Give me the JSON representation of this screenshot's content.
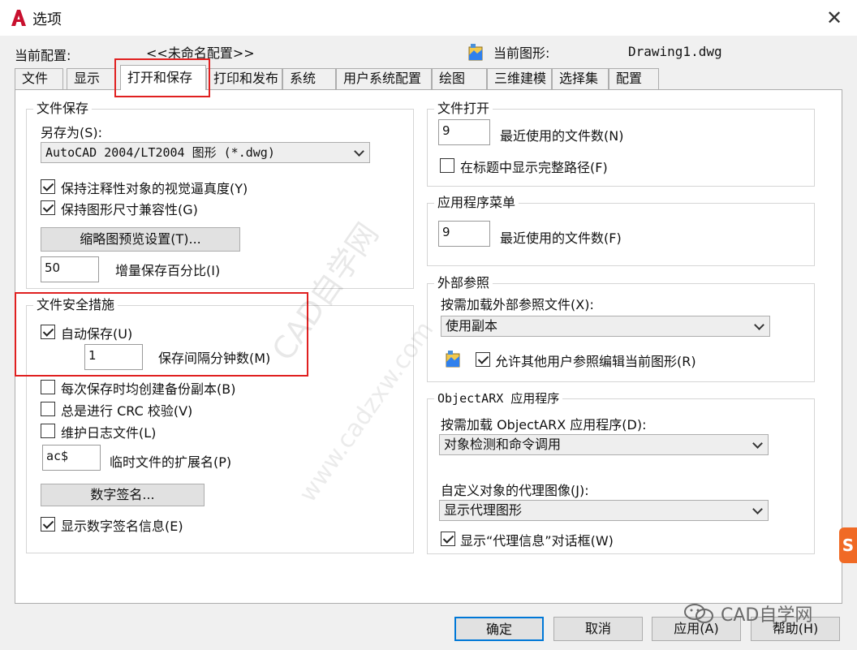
{
  "window": {
    "title": "选项",
    "close_glyph": "✕"
  },
  "profile": {
    "current_profile_label": "当前配置:",
    "current_profile_value": "<<未命名配置>>",
    "current_drawing_label": "当前图形:",
    "current_drawing_value": "Drawing1.dwg"
  },
  "tabs": [
    {
      "label": "文件"
    },
    {
      "label": "显示"
    },
    {
      "label": "打开和保存",
      "active": true
    },
    {
      "label": "打印和发布"
    },
    {
      "label": "系统"
    },
    {
      "label": "用户系统配置"
    },
    {
      "label": "绘图"
    },
    {
      "label": "三维建模"
    },
    {
      "label": "选择集"
    },
    {
      "label": "配置"
    }
  ],
  "file_save": {
    "title": "文件保存",
    "save_as_label": "另存为(S):",
    "save_as_value": "AutoCAD 2004/LT2004 图形 (*.dwg)",
    "keep_annotative_label": "保持注释性对象的视觉逼真度(Y)",
    "keep_annotative_checked": true,
    "keep_drawing_size_label": "保持图形尺寸兼容性(G)",
    "keep_drawing_size_checked": true,
    "thumbnail_button": "缩略图预览设置(T)...",
    "incremental_value": "50",
    "incremental_label": "增量保存百分比(I)"
  },
  "file_safety": {
    "title": "文件安全措施",
    "autosave_label": "自动保存(U)",
    "autosave_checked": true,
    "minutes_value": "1",
    "minutes_label": "保存间隔分钟数(M)",
    "backup_label": "每次保存时均创建备份副本(B)",
    "backup_checked": false,
    "crc_label": "总是进行 CRC 校验(V)",
    "crc_checked": false,
    "log_label": "维护日志文件(L)",
    "log_checked": false,
    "temp_ext_value": "ac$",
    "temp_ext_label": "临时文件的扩展名(P)",
    "digital_sig_button": "数字签名...",
    "show_sig_label": "显示数字签名信息(E)",
    "show_sig_checked": true
  },
  "file_open": {
    "title": "文件打开",
    "recent_value": "9",
    "recent_label": "最近使用的文件数(N)",
    "full_path_label": "在标题中显示完整路径(F)",
    "full_path_checked": false
  },
  "app_menu": {
    "title": "应用程序菜单",
    "recent_value": "9",
    "recent_label": "最近使用的文件数(F)"
  },
  "xref": {
    "title": "外部参照",
    "demand_load_label": "按需加载外部参照文件(X):",
    "demand_load_value": "使用副本",
    "allow_edit_label": "允许其他用户参照编辑当前图形(R)",
    "allow_edit_checked": true
  },
  "objectarx": {
    "title": "ObjectARX 应用程序",
    "demand_load_label": "按需加载 ObjectARX 应用程序(D):",
    "demand_load_value": "对象检测和命令调用",
    "proxy_label": "自定义对象的代理图像(J):",
    "proxy_value": "显示代理图形",
    "show_proxy_dialog_label": "显示“代理信息”对话框(W)",
    "show_proxy_dialog_checked": true
  },
  "buttons": {
    "ok": "确定",
    "cancel": "取消",
    "apply": "应用(A)",
    "help": "帮助(H)"
  },
  "watermark": {
    "line1": "CAD自学网",
    "line2": "www.cadzxw.com",
    "wechat": "CAD自学网",
    "badge": "S"
  },
  "colors": {
    "highlight_red": "#e02020",
    "focus_blue": "#0078d7",
    "app_logo_red": "#c8102e"
  }
}
